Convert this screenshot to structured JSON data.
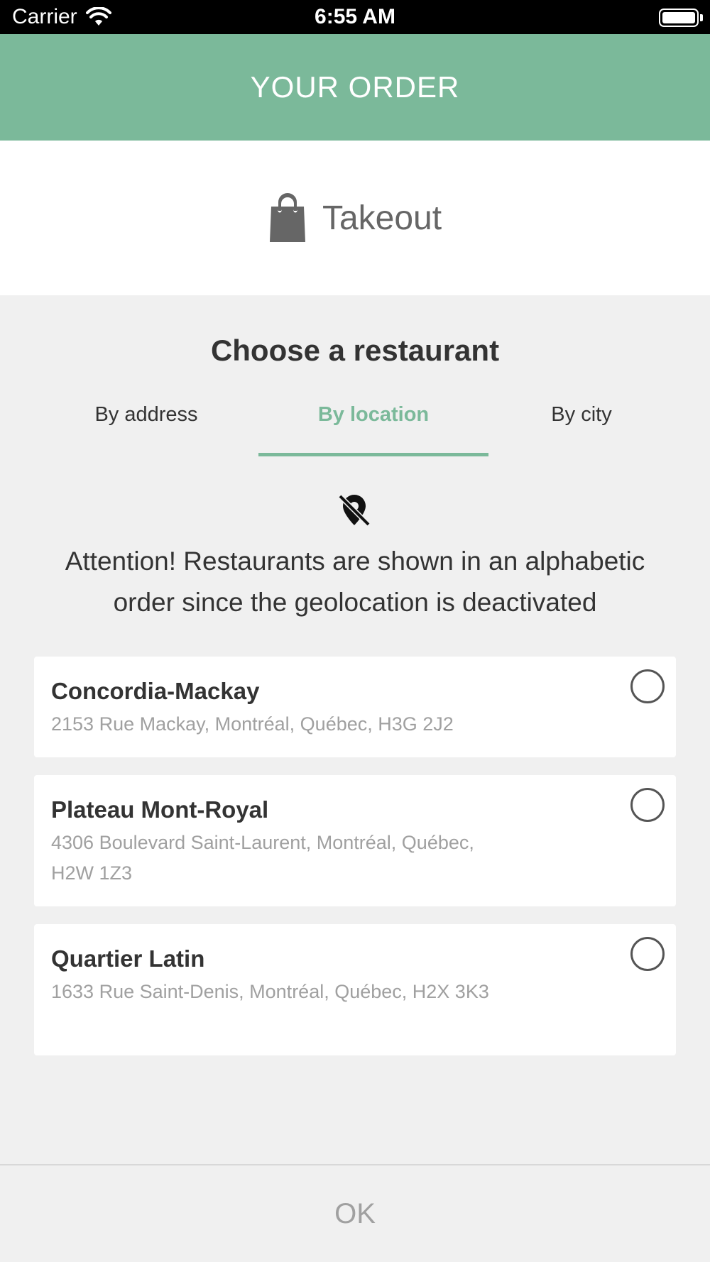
{
  "status_bar": {
    "carrier": "Carrier",
    "time": "6:55 AM"
  },
  "header": {
    "title": "YOUR ORDER"
  },
  "order_type": {
    "label": "Takeout",
    "icon": "shopping-bag-icon"
  },
  "chooser": {
    "title": "Choose a restaurant",
    "tabs": [
      {
        "label": "By address",
        "active": false
      },
      {
        "label": "By location",
        "active": true
      },
      {
        "label": "By city",
        "active": false
      }
    ],
    "notice_icon": "location-off-icon",
    "notice": "Attention! Restaurants are shown in an alphabetic order since the geolocation is deactivated"
  },
  "restaurants": [
    {
      "name": "Concordia-Mackay",
      "address": "2153 Rue Mackay, Montréal, Québec, H3G 2J2",
      "selected": false
    },
    {
      "name": "Plateau Mont-Royal",
      "address": "4306 Boulevard Saint-Laurent, Montréal, Québec, H2W 1Z3",
      "selected": false
    },
    {
      "name": "Quartier Latin",
      "address": "1633 Rue Saint-Denis, Montréal, Québec, H2X 3K3",
      "selected": false
    }
  ],
  "footer": {
    "ok_label": "OK"
  },
  "colors": {
    "accent": "#7bb99a",
    "background": "#f0f0f0",
    "muted_text": "#a0a0a0"
  }
}
